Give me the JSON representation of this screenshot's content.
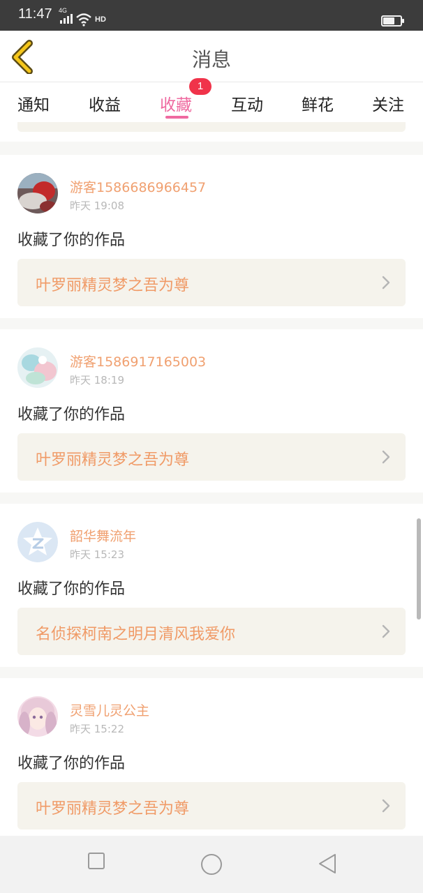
{
  "status_bar": {
    "time": "11:47",
    "network": "4G",
    "hd": "HD",
    "battery_level": 0.65
  },
  "header": {
    "title": "消息",
    "back_icon": "chevron-left-icon"
  },
  "tabs": [
    {
      "label": "通知"
    },
    {
      "label": "收益"
    },
    {
      "label": "收藏",
      "active": true,
      "badge": "1"
    },
    {
      "label": "互动"
    },
    {
      "label": "鲜花"
    },
    {
      "label": "关注"
    }
  ],
  "messages": [
    {
      "username": "游客1586686966457",
      "time": "昨天 19:08",
      "action": "收藏了你的作品",
      "work_title": "叶罗丽精灵梦之吾为尊"
    },
    {
      "username": "游客1586917165003",
      "time": "昨天 18:19",
      "action": "收藏了你的作品",
      "work_title": "叶罗丽精灵梦之吾为尊"
    },
    {
      "username": "韶华舞流年",
      "time": "昨天 15:23",
      "action": "收藏了你的作品",
      "work_title": "名侦探柯南之明月清风我爱你"
    },
    {
      "username": "灵雪儿灵公主",
      "time": "昨天 15:22",
      "action": "收藏了你的作品",
      "work_title": "叶罗丽精灵梦之吾为尊"
    }
  ],
  "colors": {
    "accent": "#ef6aa0",
    "badge": "#f0334a",
    "username": "#f0a070",
    "work_title": "#f09a66",
    "link_bg": "#f5f3ec"
  },
  "nav": {
    "icons": [
      "square-recents-icon",
      "circle-home-icon",
      "triangle-back-icon"
    ]
  }
}
